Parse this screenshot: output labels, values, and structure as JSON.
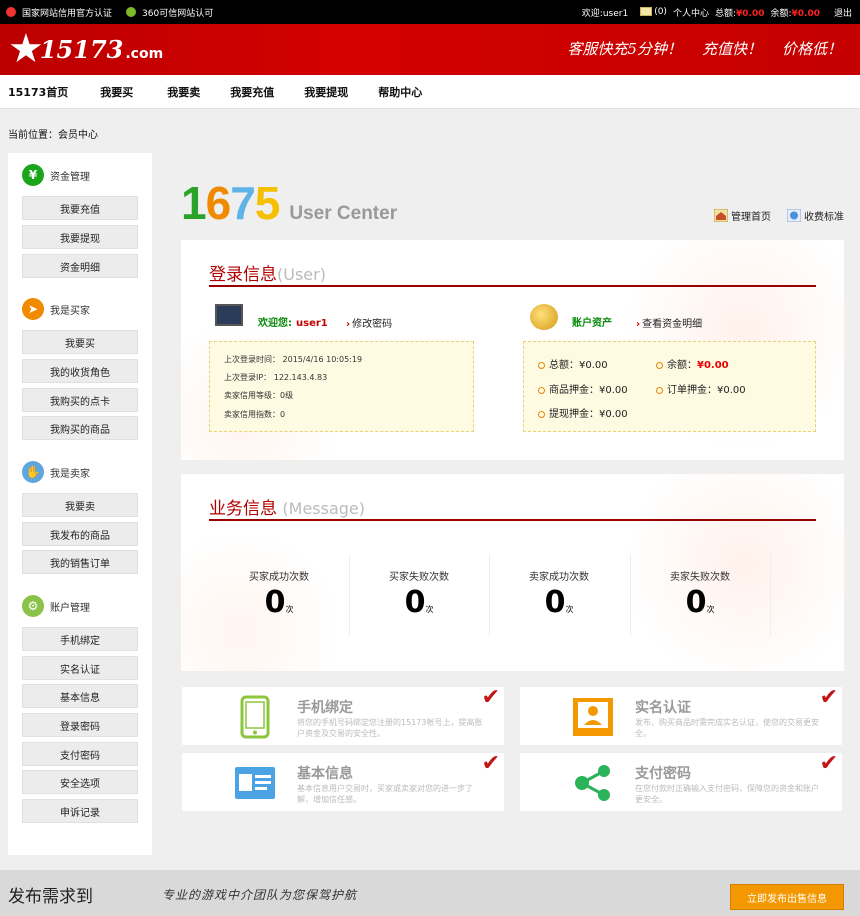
{
  "topbar": {
    "badge1": "国家网站信用官方认证",
    "badge2": "360可信网站认可",
    "welcome_prefix": "欢迎",
    "username": ":user1",
    "mail_count": "(0)",
    "personal_center": "个人中心",
    "total_label": "总额:",
    "total_value": "¥0.00",
    "balance_label": "余额:",
    "balance_value": "¥0.00",
    "logout": "退出"
  },
  "header": {
    "logo_num": "15173",
    "logo_dotcom": ".com",
    "slogans": [
      "客服快充5分钟！",
      "充值快！",
      "价格低！"
    ]
  },
  "nav": [
    "15173首页",
    "我要买",
    "我要卖",
    "我要充值",
    "我要提现",
    "帮助中心"
  ],
  "breadcrumb": "当前位置：会员中心",
  "sidebar": {
    "groups": [
      {
        "title": "资金管理",
        "icon": "yen-icon",
        "color": "#1ba51b",
        "items": [
          "我要充值",
          "我要提现",
          "资金明细"
        ]
      },
      {
        "title": "我是买家",
        "icon": "cursor-icon",
        "color": "#f08a00",
        "items": [
          "我要买",
          "我的收货角色",
          "我购买的点卡",
          "我购买的商品"
        ]
      },
      {
        "title": "我是卖家",
        "icon": "handshake-icon",
        "color": "#5fa6de",
        "items": [
          "我要卖",
          "我发布的商品",
          "我的销售订单"
        ]
      },
      {
        "title": "账户管理",
        "icon": "gear-icon",
        "color": "#8bc34a",
        "items": [
          "手机绑定",
          "实名认证",
          "基本信息",
          "登录密码",
          "支付密码",
          "安全选项",
          "申诉记录"
        ]
      }
    ]
  },
  "main": {
    "logo_digits": [
      "1",
      "6",
      "7",
      "5"
    ],
    "logo_colors": [
      "#2aa32a",
      "#f08a00",
      "#5fb3e6",
      "#f5c000"
    ],
    "logo_text": "User Center",
    "manage_home": "管理首页",
    "fee_standard": "收费标准"
  },
  "login_panel": {
    "title": "登录信息",
    "title_en": "(User)",
    "welcome": "欢迎您:",
    "username": "user1",
    "change_password": "修改密码",
    "rows": [
      "上次登录时间： 2015/4/16 10:05:19",
      "上次登录IP： 122.143.4.83",
      "卖家信用等级：0级",
      "卖家信用指数：0"
    ],
    "assets_title": "账户资产",
    "view_details": "查看资金明细",
    "assets": {
      "total_label": "总额：",
      "total_value": "¥0.00",
      "balance_label": "余额：",
      "balance_value": "¥0.00",
      "goods_deposit_label": "商品押金：",
      "goods_deposit_value": "¥0.00",
      "order_deposit_label": "订单押金：",
      "order_deposit_value": "¥0.00",
      "withdraw_deposit_label": "提现押金：",
      "withdraw_deposit_value": "¥0.00"
    }
  },
  "business_panel": {
    "title": "业务信息",
    "title_en": "(Message)",
    "stats": [
      {
        "label": "买家成功次数",
        "value": "0",
        "unit": "次"
      },
      {
        "label": "买家失败次数",
        "value": "0",
        "unit": "次"
      },
      {
        "label": "卖家成功次数",
        "value": "0",
        "unit": "次"
      },
      {
        "label": "卖家失败次数",
        "value": "0",
        "unit": "次"
      }
    ]
  },
  "cards": [
    {
      "title": "手机绑定",
      "desc": "将您的手机号码绑定您注册的15173帐号上，提高账户资金及交易的安全性。",
      "icon": "phone-icon",
      "color": "#8cc63f"
    },
    {
      "title": "实名认证",
      "desc": "发布、购买商品时需完成实名认证，使您的交易更安全。",
      "icon": "id-photo-icon",
      "color": "#f39800"
    },
    {
      "title": "基本信息",
      "desc": "基本信息用户交易时，买家或卖家对您的进一步了解，增加信任感。",
      "icon": "id-card-icon",
      "color": "#4ba3e3"
    },
    {
      "title": "支付密码",
      "desc": "在您付款时正确输入支付密码，保障您的资金和账户更安全。",
      "icon": "share-icon",
      "color": "#2bb35a"
    }
  ],
  "bottom": {
    "title": "发布需求到",
    "slogan": "专业的游戏中介团队为您保驾护航",
    "button": "立即发布出售信息"
  }
}
